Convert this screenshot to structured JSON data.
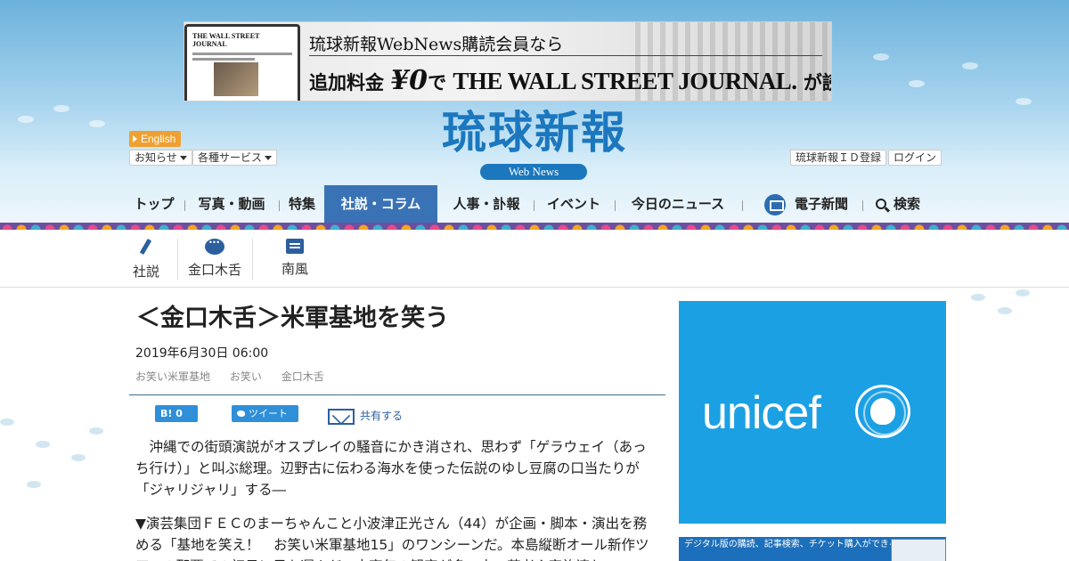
{
  "banner": {
    "line1": "琉球新報WebNews購読会員なら",
    "line2_a": "追加料金 ",
    "line2_zero": "¥0",
    "line2_b": "で ",
    "line2_wsj": "THE WALL STREET JOURNAL.",
    "line2_c": " が読める",
    "laptop_text": "THE WALL STREET JOURNAL"
  },
  "logo": {
    "title": "琉球新報",
    "subtitle": "Web News"
  },
  "utility": {
    "english": "English",
    "notices": "お知らせ",
    "services": "各種サービス",
    "register": "琉球新報ＩＤ登録",
    "login": "ログイン"
  },
  "nav": {
    "items": [
      "トップ",
      "写真・動画",
      "特集",
      "社説・コラム",
      "人事・訃報",
      "イベント",
      "今日のニュース",
      "電子新聞",
      "検索"
    ],
    "active": "社説・コラム"
  },
  "subnav": {
    "items": [
      "社説",
      "金口木舌",
      "南風"
    ]
  },
  "article": {
    "headline": "＜金口木舌＞米軍基地を笑う",
    "date": "2019年6月30日 06:00",
    "tags": [
      "お笑い米軍基地",
      "お笑い",
      "金口木舌"
    ],
    "hatena_count": "B! 0",
    "tweet": "ツイート",
    "share": "共有する",
    "paragraphs": [
      "　沖縄での街頭演説がオスプレイの騒音にかき消され、思わず「ゲラウェイ（あっち行け）」と叫ぶ総理。辺野古に伝わる海水を使った伝説のゆし豆腐の口当たりが「ジャリジャリ」する―",
      "▼演芸集団ＦＥＣのまーちゃんこと小波津正光さん（44）が企画・脚本・演出を務める「基地を笑え！　お笑い米軍基地15」のワンシーンだ。本島縦断オール新作ツアーの那覇での初日に足を運んだ。中高年の観客が多い中、若者や家族連れ"
    ]
  },
  "ads": {
    "unicef": "unicef",
    "digital": "デジタル版の購読、記事検索、チケット購入ができる"
  },
  "colors": {
    "brand_blue": "#1b77be",
    "nav_active": "#3a73b5",
    "unicef_blue": "#1ca0e4",
    "english_orange": "#f0a030"
  }
}
